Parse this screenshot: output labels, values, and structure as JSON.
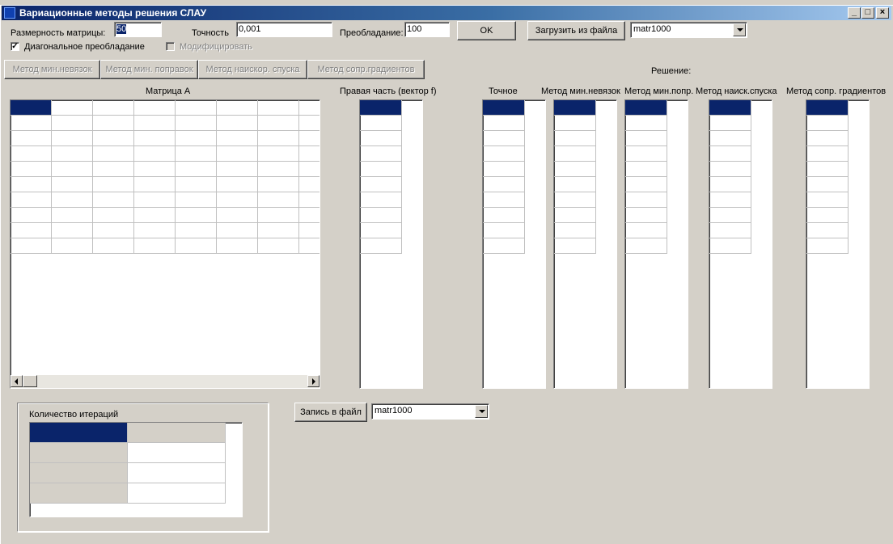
{
  "window": {
    "title": "Вариационные методы решения СЛАУ",
    "controls": {
      "minimize": "_",
      "maximize": "□",
      "close": "×"
    }
  },
  "params": {
    "size_label": "Размерность матрицы:",
    "size_value": "50",
    "precision_label": "Точность",
    "precision_value": "0,001",
    "dominance_label": "Преобладание:",
    "dominance_value": "100",
    "ok_label": "OK",
    "load_label": "Загрузить из файла",
    "load_file": "matr1000",
    "diag_label": "Диагональное преобладание",
    "diag_checked": "✓",
    "mod_label": "Модифицировать"
  },
  "methods": {
    "min_residual": "Метод мин.невязок",
    "min_correction": "Метод мин. поправок",
    "steepest": "Метод наискор. спуска",
    "conj_grad": "Метод сопр.градиентов"
  },
  "matrix": {
    "title": "Матрица A"
  },
  "rhs": {
    "title": "Правая часть (вектор f)"
  },
  "solution": {
    "title": "Решение:",
    "exact": "Точное",
    "min_residual": "Метод мин.невязок",
    "min_correction": "Метод мин.попр.",
    "steepest": "Метод наиск.спуска",
    "conj_grad": "Метод сопр. градиентов"
  },
  "iterations": {
    "title": "Количество итераций"
  },
  "save": {
    "button": "Запись в файл",
    "file": "matr1000"
  },
  "colors": {
    "selection": "#0a246a",
    "face": "#d4d0c8"
  }
}
